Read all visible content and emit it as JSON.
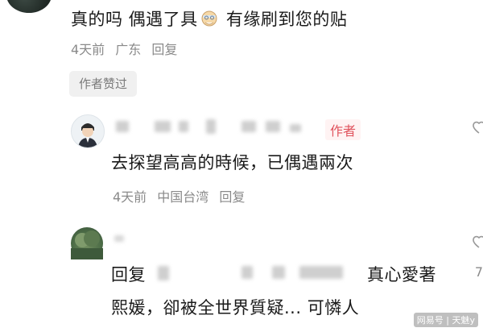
{
  "comment_top": {
    "text_before_emoji": "真的吗 偶遇了具",
    "text_after_emoji": " 有缘刷到您的贴",
    "emoji_icon": "grandpa-emoji-icon",
    "time": "4天前",
    "location": "广东",
    "reply_label": "回复",
    "liked_badge": "作者赞过"
  },
  "reply_author": {
    "tag": "作者",
    "text": "去探望高高的時候，已偶遇兩次",
    "time": "4天前",
    "location": "中国台湾",
    "reply_label": "回复"
  },
  "reply_second": {
    "reply_prefix": "回复",
    "text_suffix": "真心愛著",
    "line2": "熙媛，卻被全世界質疑... 可憐人",
    "side_count": "7"
  },
  "watermark": "网易号 | 天魅y",
  "colors": {
    "author_red": "#e0535d",
    "meta_gray": "#8a8a8a"
  }
}
